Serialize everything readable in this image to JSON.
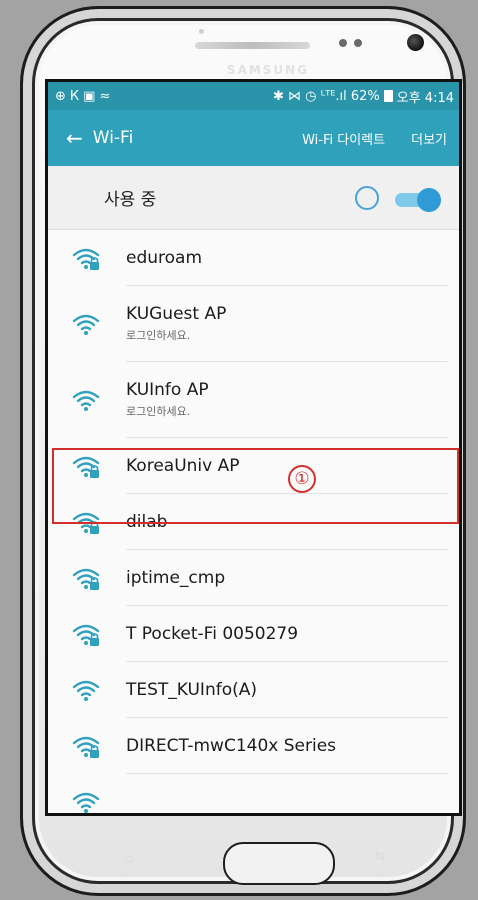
{
  "device": {
    "brand": "SAMSUNG",
    "softkey_left": "ㅁ",
    "softkey_right": "⇆"
  },
  "status_bar": {
    "left_icons": [
      "⊕",
      "К",
      "▣",
      "≈"
    ],
    "right_text": "✱ ⋈ ◷ ᴸᵀᴱ.ıl 62%",
    "time": "오후 4:14"
  },
  "app_bar": {
    "title": "Wi-Fi",
    "wifi_direct": "Wi-Fi 다이렉트",
    "more": "더보기"
  },
  "master_switch": {
    "label": "사용 중",
    "state": "on"
  },
  "networks": [
    {
      "name": "eduroam",
      "sub": "",
      "secured": true
    },
    {
      "name": "KUGuest AP",
      "sub": "로그인하세요.",
      "secured": false
    },
    {
      "name": "KUInfo AP",
      "sub": "로그인하세요.",
      "secured": false
    },
    {
      "name": "KoreaUniv AP",
      "sub": "",
      "secured": true
    },
    {
      "name": "dilab",
      "sub": "",
      "secured": true
    },
    {
      "name": "iptime_cmp",
      "sub": "",
      "secured": true
    },
    {
      "name": "T Pocket-Fi 0050279",
      "sub": "",
      "secured": true
    },
    {
      "name": "TEST_KUInfo(A)",
      "sub": "",
      "secured": false
    },
    {
      "name": "DIRECT-mwC140x Series",
      "sub": "",
      "secured": true
    },
    {
      "name": "",
      "sub": "",
      "secured": false
    }
  ],
  "annotation": {
    "marker": "①"
  },
  "colors": {
    "status_bar": "#2a94ab",
    "app_bar": "#30a1bb",
    "wifi_icon": "#30a1bb",
    "highlight": "#d32f2f"
  }
}
